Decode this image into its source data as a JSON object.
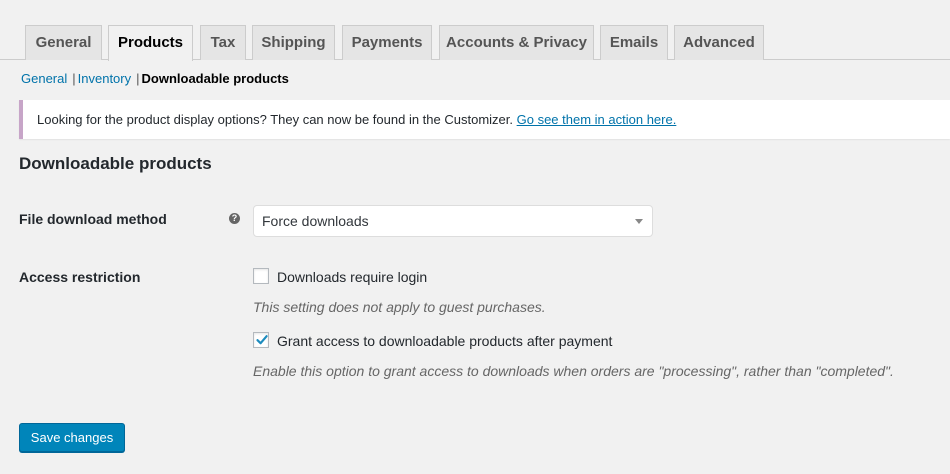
{
  "tabs": [
    {
      "label": "General",
      "active": false
    },
    {
      "label": "Products",
      "active": true
    },
    {
      "label": "Tax",
      "active": false
    },
    {
      "label": "Shipping",
      "active": false
    },
    {
      "label": "Payments",
      "active": false
    },
    {
      "label": "Accounts & Privacy",
      "active": false
    },
    {
      "label": "Emails",
      "active": false
    },
    {
      "label": "Advanced",
      "active": false
    }
  ],
  "subnav": {
    "general": "General",
    "inventory": "Inventory",
    "current": "Downloadable products",
    "separator": "|"
  },
  "notice": {
    "text": "Looking for the product display options? They can now be found in the Customizer.",
    "link": "Go see them in action here.",
    "border_color": "#c7a5c8"
  },
  "section_title": "Downloadable products",
  "fields": {
    "download_method": {
      "label": "File download method",
      "help_icon": "question-circle-icon",
      "help_glyph": "?",
      "value": "Force downloads"
    },
    "access_restriction": {
      "label": "Access restriction",
      "require_login": {
        "label": "Downloads require login",
        "checked": false,
        "description": "This setting does not apply to guest purchases."
      },
      "grant_access": {
        "label": "Grant access to downloadable products after payment",
        "checked": true,
        "description": "Enable this option to grant access to downloads when orders are \"processing\", rather than \"completed\"."
      }
    }
  },
  "save_button": "Save changes",
  "colors": {
    "accent": "#0085ba",
    "link": "#0073aa",
    "background": "#f1f1f1"
  }
}
